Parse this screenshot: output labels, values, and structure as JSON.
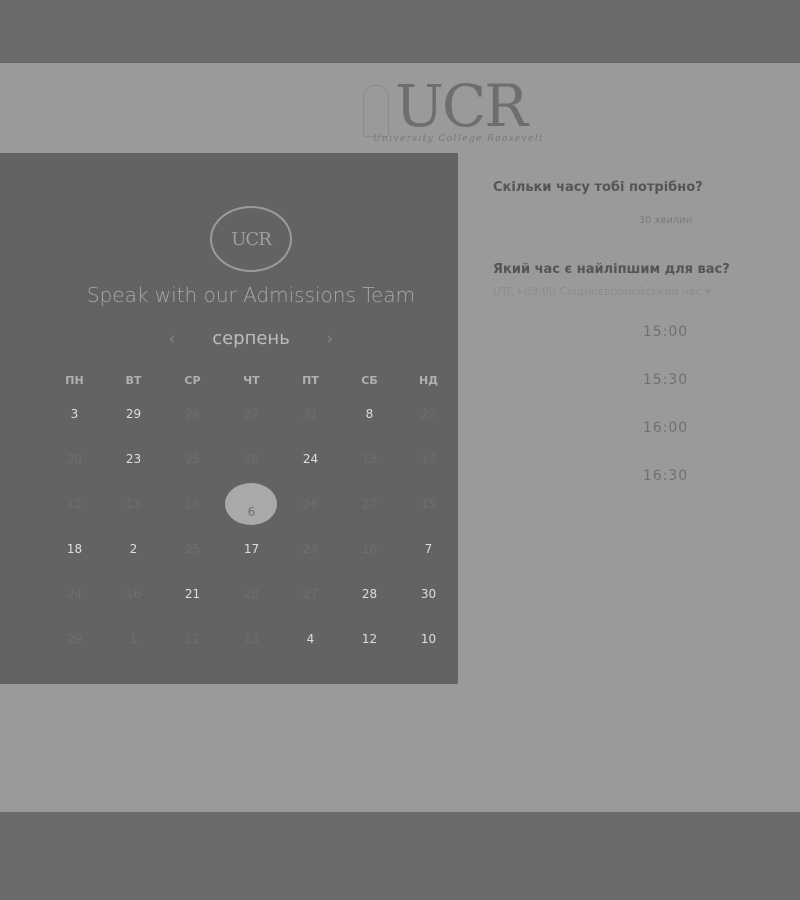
{
  "logo": {
    "letters": "UCR",
    "tagline": "University College Roosevelt"
  },
  "calendar": {
    "badge": "UCR",
    "title": "Speak with our Admissions Team",
    "month": "серпень",
    "prev_icon": "‹",
    "next_icon": "›",
    "weekdays": [
      "ПН",
      "ВТ",
      "СР",
      "ЧТ",
      "ПТ",
      "СБ",
      "НД"
    ],
    "weeks": [
      [
        {
          "d": "3",
          "a": true
        },
        {
          "d": "29",
          "a": true
        },
        {
          "d": "26",
          "a": false
        },
        {
          "d": "27",
          "a": false
        },
        {
          "d": "31",
          "a": false
        },
        {
          "d": "8",
          "a": true
        },
        {
          "d": "22",
          "a": false
        }
      ],
      [
        {
          "d": "20",
          "a": false
        },
        {
          "d": "23",
          "a": true
        },
        {
          "d": "25",
          "a": false
        },
        {
          "d": "30",
          "a": false
        },
        {
          "d": "24",
          "a": true
        },
        {
          "d": "13",
          "a": false
        },
        {
          "d": "14",
          "a": false
        }
      ],
      [
        {
          "d": "12",
          "a": false
        },
        {
          "d": "13",
          "a": false
        },
        {
          "d": "14",
          "a": false
        },
        {
          "d": "6",
          "a": true,
          "sel": true
        },
        {
          "d": "26",
          "a": false
        },
        {
          "d": "27",
          "a": false
        },
        {
          "d": "15",
          "a": false
        }
      ],
      [
        {
          "d": "18",
          "a": true
        },
        {
          "d": "2",
          "a": true
        },
        {
          "d": "25",
          "a": false
        },
        {
          "d": "17",
          "a": true
        },
        {
          "d": "24",
          "a": false
        },
        {
          "d": "16",
          "a": false
        },
        {
          "d": "7",
          "a": true
        }
      ],
      [
        {
          "d": "24",
          "a": false
        },
        {
          "d": "16",
          "a": false
        },
        {
          "d": "21",
          "a": true
        },
        {
          "d": "20",
          "a": false
        },
        {
          "d": "27",
          "a": false
        },
        {
          "d": "28",
          "a": true
        },
        {
          "d": "30",
          "a": true
        }
      ],
      [
        {
          "d": "29",
          "a": false
        },
        {
          "d": "1",
          "a": false
        },
        {
          "d": "12",
          "a": false
        },
        {
          "d": "13",
          "a": false
        },
        {
          "d": "4",
          "a": true
        },
        {
          "d": "12",
          "a": true
        },
        {
          "d": "10",
          "a": true
        }
      ]
    ]
  },
  "booking": {
    "duration_question": "Скільки часу тобі потрібно?",
    "duration_value": "30 хвилин",
    "time_question": "Який час є найліпшим для вас?",
    "timezone": "UTC+03:00 Східноєвропейський час ▾",
    "slots": [
      "15:00",
      "15:30",
      "16:00",
      "16:30"
    ]
  }
}
